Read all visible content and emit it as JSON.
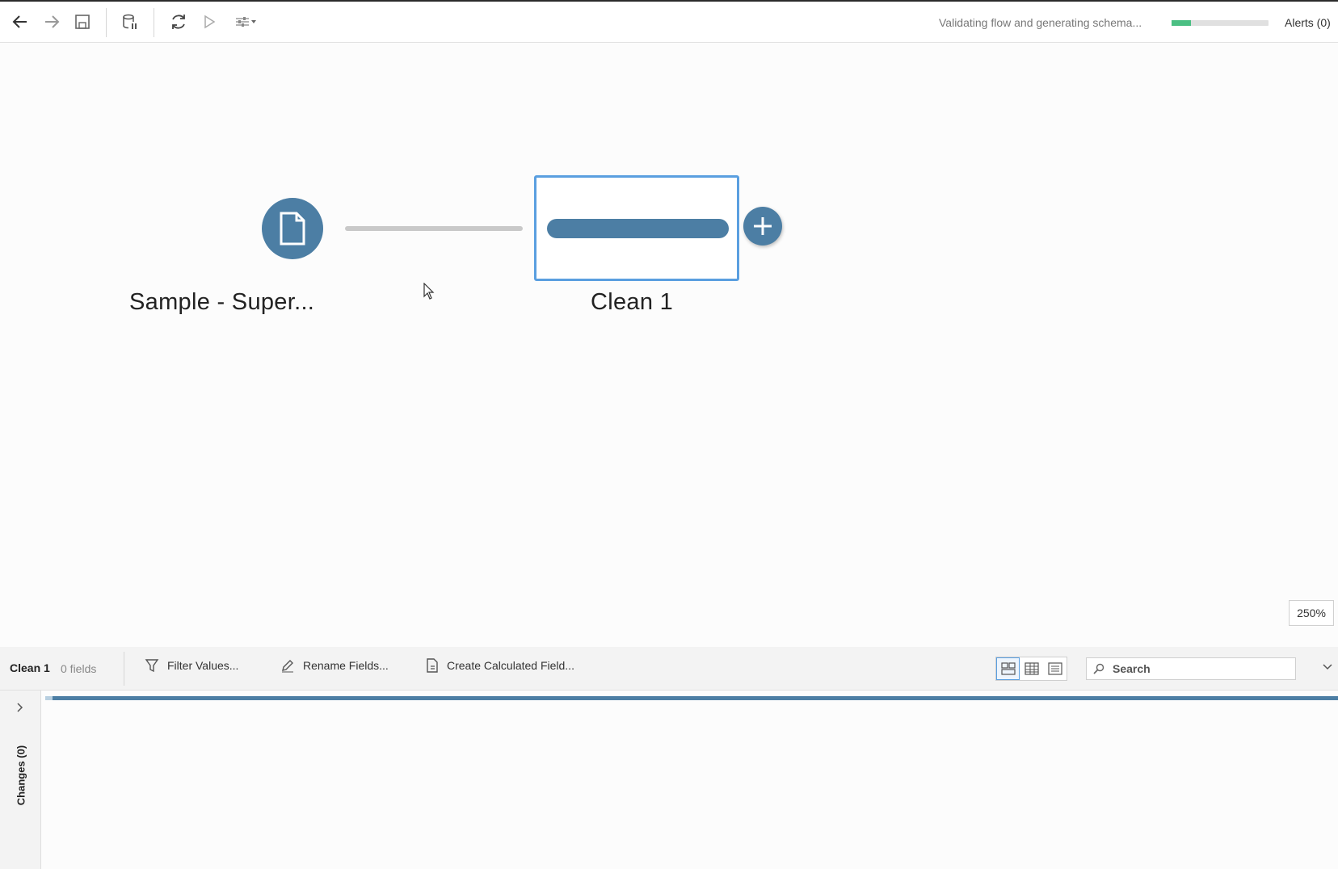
{
  "toolbar": {
    "status_text": "Validating flow and generating schema...",
    "progress_fraction": 0.2,
    "alerts_label": "Alerts (0)"
  },
  "canvas": {
    "input_node_label": "Sample - Super...",
    "clean_node_label": "Clean 1",
    "zoom_level": "250%"
  },
  "profile": {
    "step_name": "Clean 1",
    "field_count": "0 fields",
    "filter_label": "Filter Values...",
    "rename_label": "Rename Fields...",
    "calc_label": "Create Calculated Field...",
    "search_placeholder": "Search"
  },
  "changes": {
    "label": "Changes (0)"
  },
  "colors": {
    "node_blue": "#4c7ea4",
    "selection_blue": "#5a9fe0",
    "progress_green": "#4bbf83"
  }
}
